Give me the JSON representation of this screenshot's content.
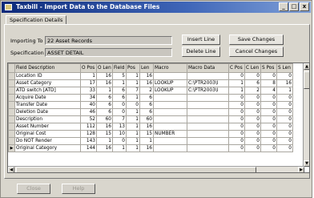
{
  "window": {
    "title": "Taxbill - Import Data to the Database Files",
    "buttons": {
      "minimize": "_",
      "maximize": "□",
      "close": "x"
    }
  },
  "tabs": [
    {
      "label": "Specification Details"
    }
  ],
  "form": {
    "importing_to_label": "Importing To",
    "importing_to_value": "22 Asset Records",
    "specification_label": "Specification",
    "specification_value": "ASSET DETAIL"
  },
  "buttons": {
    "insert_line": "Insert Line",
    "delete_line": "Delete Line",
    "save_changes": "Save Changes",
    "cancel_changes": "Cancel Changes",
    "close": "Close",
    "help": "Help"
  },
  "grid": {
    "columns": [
      "Field Description",
      "O Pos",
      "O Len",
      "Field",
      "Pos",
      "Len",
      "Macro",
      "Macro Data",
      "C Pos",
      "C Len",
      "S Pos",
      "S Len"
    ],
    "rows": [
      [
        "Location ID",
        "1",
        "16",
        "5",
        "1",
        "16",
        "",
        "",
        "0",
        "0",
        "0",
        "0"
      ],
      [
        "Asset Category",
        "17",
        "16",
        "1",
        "1",
        "16",
        "LOOKUP",
        "C:\\PTR2003\\I",
        "1",
        "6",
        "8",
        "16"
      ],
      [
        "ATD switch [ATD]",
        "33",
        "1",
        "6",
        "7",
        "2",
        "LOOKUP",
        "C:\\PTR2003\\I",
        "1",
        "2",
        "4",
        "1"
      ],
      [
        "Acquire Date",
        "34",
        "6",
        "6",
        "1",
        "6",
        "",
        "",
        "0",
        "0",
        "0",
        "0"
      ],
      [
        "Transfer Date",
        "40",
        "6",
        "0",
        "0",
        "6",
        "",
        "",
        "0",
        "0",
        "0",
        "0"
      ],
      [
        "Deletion Date",
        "46",
        "6",
        "0",
        "1",
        "6",
        "",
        "",
        "0",
        "0",
        "0",
        "0"
      ],
      [
        "Description",
        "52",
        "60",
        "7",
        "1",
        "60",
        "",
        "",
        "0",
        "0",
        "0",
        "0"
      ],
      [
        "Asset Number",
        "112",
        "16",
        "13",
        "1",
        "16",
        "",
        "",
        "0",
        "0",
        "0",
        "0"
      ],
      [
        "Original Cost",
        "128",
        "15",
        "10",
        "1",
        "15",
        "NUMBER",
        "",
        "0",
        "0",
        "0",
        "0"
      ],
      [
        "Do NOT Render",
        "143",
        "1",
        "0",
        "1",
        "1",
        "",
        "",
        "0",
        "0",
        "0",
        "0"
      ],
      [
        "Original Category",
        "144",
        "16",
        "1",
        "1",
        "16",
        "",
        "",
        "0",
        "0",
        "0",
        "0"
      ]
    ]
  },
  "icons": {
    "app": "taxbill-app-icon",
    "row_selector": "record-pointer-icon",
    "scroll_up": "▲",
    "scroll_down": "▼",
    "scroll_left": "◀",
    "scroll_right": "▶"
  }
}
